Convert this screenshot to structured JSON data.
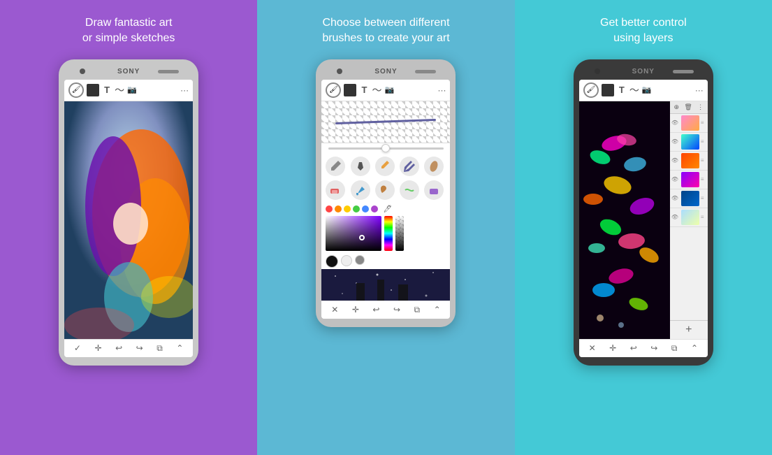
{
  "panels": [
    {
      "id": "panel-1",
      "caption_line1": "Draw fantastic art",
      "caption_line2": "or simple sketches",
      "bg": "#9b59d0"
    },
    {
      "id": "panel-2",
      "caption_line1": "Choose between different",
      "caption_line2": "brushes to create your art",
      "bg": "#5cb8d4"
    },
    {
      "id": "panel-3",
      "caption_line1": "Get better control",
      "caption_line2": "using layers",
      "bg": "#44c9d6"
    }
  ],
  "toolbar": {
    "brand": "SONY",
    "tools": [
      "brush",
      "square",
      "T",
      "mustache",
      "camera",
      "more"
    ]
  },
  "bottom_bar": {
    "icons": [
      "check",
      "move",
      "undo",
      "redo",
      "layers",
      "expand"
    ]
  },
  "colors": {
    "purple_bg": "#9b59d0",
    "blue_bg": "#5cb8d4",
    "teal_bg": "#44c9d6"
  }
}
